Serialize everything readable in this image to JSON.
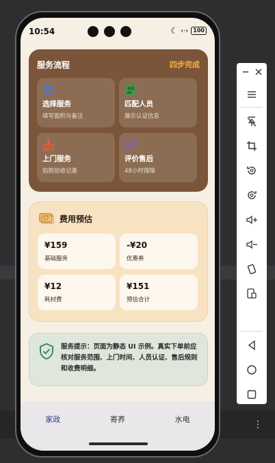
{
  "status": {
    "time": "10:54",
    "battery": "100"
  },
  "flow": {
    "title": "服务流程",
    "badge": "四步完成",
    "steps": [
      {
        "title": "选择服务",
        "sub": "填写面积与备注",
        "icon": "calendar-icon",
        "color": "#4b78d8"
      },
      {
        "title": "匹配人员",
        "sub": "展示认证信息",
        "icon": "people-icon",
        "color": "#3c9a4a"
      },
      {
        "title": "上门服务",
        "sub": "拍照验收记录",
        "icon": "broom-icon",
        "color": "#e0603e"
      },
      {
        "title": "评价售后",
        "sub": "48小时保障",
        "icon": "chat-icon",
        "color": "#8b5bd6"
      }
    ]
  },
  "estimate": {
    "title": "费用预估",
    "fees": [
      {
        "value": "¥159",
        "label": "基础服务"
      },
      {
        "value": "-¥20",
        "label": "优惠券"
      },
      {
        "value": "¥12",
        "label": "耗材费"
      },
      {
        "value": "¥151",
        "label": "预估合计"
      }
    ]
  },
  "tip": {
    "text": "服务提示：页面为静态 UI 示例。真实下单前应核对服务范围、上门时间、人员认证、售后规则和收费明细。"
  },
  "tabs": [
    {
      "label": "家政"
    },
    {
      "label": "寄养"
    },
    {
      "label": "水电"
    }
  ],
  "colors": {
    "brown": "#7a5539",
    "accent": "#f4b23c",
    "activeTab": "#2f3c8c"
  }
}
